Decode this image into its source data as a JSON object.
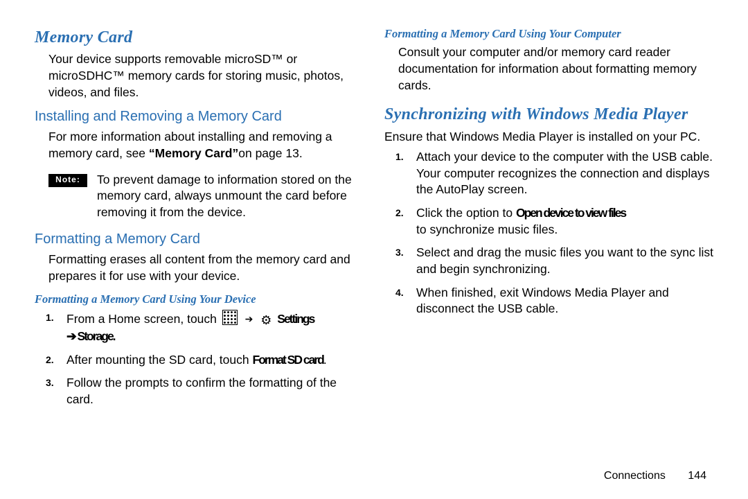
{
  "left": {
    "h1": "Memory Card",
    "p1": "Your device supports removable microSD™ or microSDHC™ memory cards for storing music, photos, videos, and files.",
    "h2a": "Installing and Removing a Memory Card",
    "p2a": "For more information about installing and removing a memory card, see ",
    "p2b": "“Memory Card”",
    "p2c": "on page 13.",
    "noteLabel": "Note:",
    "noteText": "To prevent damage to information stored on the memory card, always unmount the card before removing it from the device.",
    "h2b": "Formatting a Memory Card",
    "p3": "Formatting erases all content from the memory card and prepares it for use with your device.",
    "h3a": "Formatting a Memory Card Using Your Device",
    "steps": [
      {
        "marker": "1.",
        "pre": "From a Home screen, touch",
        "iconApps": true,
        "arrow": "➔",
        "settings": "⚙",
        "tail1": "Settings",
        "tail2": "➔ Storage."
      },
      {
        "marker": "2.",
        "pre": "After mounting the SD card, touch",
        "tail1": "Format SD card",
        "tail_suffix": "."
      },
      {
        "marker": "3.",
        "pre": "Follow the prompts to confirm the formatting of the card."
      }
    ]
  },
  "right": {
    "h3b": "Formatting a Memory Card Using Your Computer",
    "p4": "Consult your computer and/or memory card reader documentation for information about formatting memory cards.",
    "h1b": "Synchronizing with Windows Media Player",
    "p5": "Ensure that Windows Media Player is installed on your PC.",
    "steps": [
      {
        "marker": "1.",
        "text": "Attach your device to the computer with the USB cable.",
        "sub": "Your computer recognizes the connection and displays the AutoPlay screen."
      },
      {
        "marker": "2.",
        "text_pre": "Click the option to ",
        "ghost": "Open device to view files",
        "text_post": " to synchronize music files."
      },
      {
        "marker": "3.",
        "text": "Select and drag the music files you want to the sync list and begin synchronizing."
      },
      {
        "marker": "4.",
        "text": "When finished, exit Windows Media Player and disconnect the USB cable."
      }
    ]
  },
  "footer": {
    "section": "Connections",
    "page": "144"
  }
}
